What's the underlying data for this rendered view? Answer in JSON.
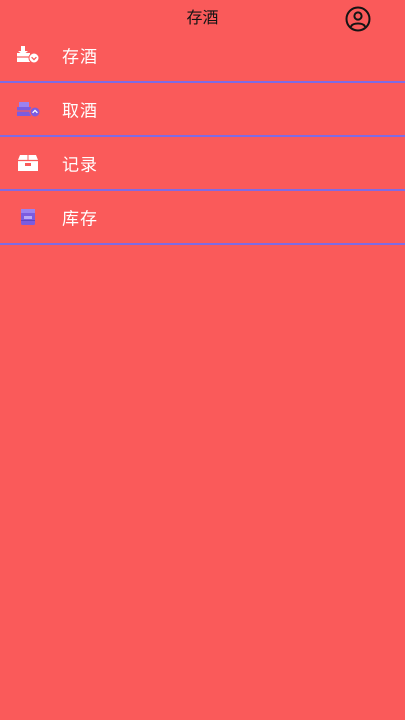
{
  "header": {
    "title": "存酒",
    "profile_icon": "user-circle-icon"
  },
  "menu": {
    "items": [
      {
        "label": "存酒",
        "icon": "deposit-box-icon"
      },
      {
        "label": "取酒",
        "icon": "withdraw-box-icon"
      },
      {
        "label": "记录",
        "icon": "record-box-icon"
      },
      {
        "label": "库存",
        "icon": "inventory-box-icon"
      }
    ]
  },
  "colors": {
    "background": "#FA5A5A",
    "divider": "#7F6BE3",
    "icon_purple": "#7B5CE0",
    "icon_white": "#FFFFFF",
    "title_text": "#141414",
    "label_text": "#FFFFFF"
  }
}
